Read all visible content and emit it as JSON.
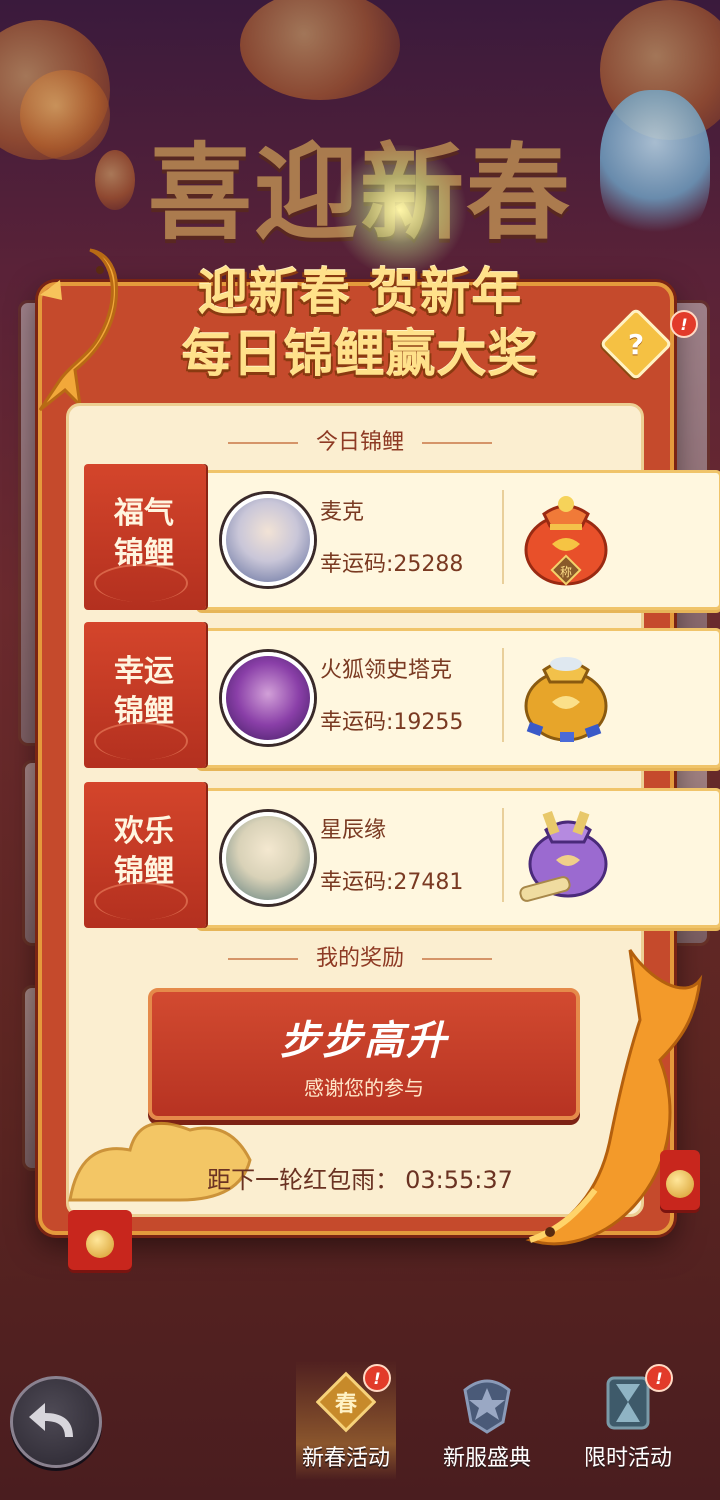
{
  "banner": {
    "background_title": "喜迎新春",
    "headline_line1": "迎新春 贺新年",
    "headline_line2": "每日锦鲤赢大奖"
  },
  "help_button": {
    "label": "?"
  },
  "today_section": {
    "title": "今日锦鲤",
    "rows": [
      {
        "tag_line1": "福气",
        "tag_line2": "锦鲤",
        "name": "麦克",
        "code": "幸运码:25288",
        "reward_icon": "title-bag-icon",
        "bag_color": "#e8502a",
        "avatar_color": "#c9c6d8"
      },
      {
        "tag_line1": "幸运",
        "tag_line2": "锦鲤",
        "name": "火狐领史塔克",
        "code": "幸运码:19255",
        "reward_icon": "gold-bag-icon",
        "bag_color": "#e7a52a",
        "avatar_color": "#8a3fa8"
      },
      {
        "tag_line1": "欢乐",
        "tag_line2": "锦鲤",
        "name": "星辰缘",
        "code": "幸运码:27481",
        "reward_icon": "purple-bag-icon",
        "bag_color": "#9b6ad0",
        "avatar_color": "#d9d2b8"
      }
    ]
  },
  "my_reward": {
    "title": "我的奖励",
    "reward_name": "步步高升",
    "reward_desc": "感谢您的参与"
  },
  "countdown": {
    "label": "距下一轮红包雨：",
    "time": "03:55:37"
  },
  "nav": {
    "items": [
      {
        "label": "新春活动",
        "icon": "spring-icon",
        "active": true,
        "badge": "!"
      },
      {
        "label": "新服盛典",
        "icon": "star-crest-icon",
        "active": false
      },
      {
        "label": "限时活动",
        "icon": "hourglass-icon",
        "active": false,
        "badge": "!"
      }
    ]
  },
  "colors": {
    "panel_red": "#c54a2c",
    "cream": "#fbeed0",
    "gold": "#ffe18a"
  }
}
